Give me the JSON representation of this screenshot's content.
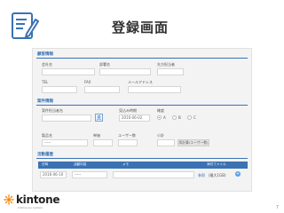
{
  "slide": {
    "title": "登録画面",
    "page_number": "7"
  },
  "sections": {
    "customer": {
      "title": "顧客情報",
      "fields": {
        "company": "会社名",
        "department": "部署名",
        "contact_name": "先方担当者",
        "tel": "TEL",
        "fax": "FAX",
        "email": "メールアドレス"
      }
    },
    "deal": {
      "title": "案件情報",
      "fields": {
        "deal_name": "案件担当者名",
        "due_date": "見込み時期",
        "due_date_value": "2016-06-02",
        "certainty": "確度",
        "certainty_options": [
          "A",
          "B",
          "C"
        ],
        "certainty_selected": "A",
        "product": "製品名",
        "unit_price": "単価",
        "user_count": "ユーザー数",
        "subtotal": "小計",
        "product_value": "-----",
        "recalc_button": "再計算(ユーザー数)"
      }
    },
    "activity": {
      "title": "活動履歴",
      "columns": [
        "日時",
        "活動内容",
        "メモ",
        "添付ファイル"
      ],
      "rows": [
        {
          "date": "2016-06-10",
          "type": "-----",
          "memo": "",
          "attachment": "参照",
          "attachment_note": "(最大1GB)"
        }
      ]
    }
  },
  "logo": {
    "name": "kintone",
    "tagline": "kintone by Cybozu"
  },
  "colors": {
    "accent": "#3a72b4",
    "logo_orange": "#f08c14"
  }
}
